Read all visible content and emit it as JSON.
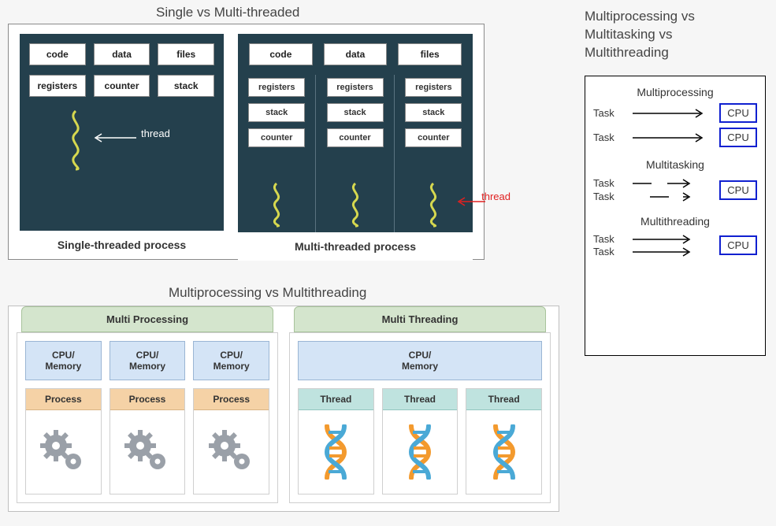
{
  "svmt": {
    "title": "Single vs Multi-threaded",
    "single_caption": "Single-threaded process",
    "multi_caption": "Multi-threaded process",
    "chips": {
      "code": "code",
      "data": "data",
      "files": "files",
      "registers": "registers",
      "counter": "counter",
      "stack": "stack"
    },
    "thread_label": "thread"
  },
  "mpmt": {
    "title": "Multiprocessing vs Multithreading",
    "mp_header": "Multi Processing",
    "mt_header": "Multi Threading",
    "cpu_label": "CPU/\nMemory",
    "process_label": "Process",
    "thread_label": "Thread"
  },
  "right": {
    "title_l1": "Multiprocessing vs",
    "title_l2": "Multitasking vs",
    "title_l3": "Multithreading",
    "sec_mp": "Multiprocessing",
    "sec_mt": "Multitasking",
    "sec_mth": "Multithreading",
    "task": "Task",
    "cpu": "CPU"
  }
}
